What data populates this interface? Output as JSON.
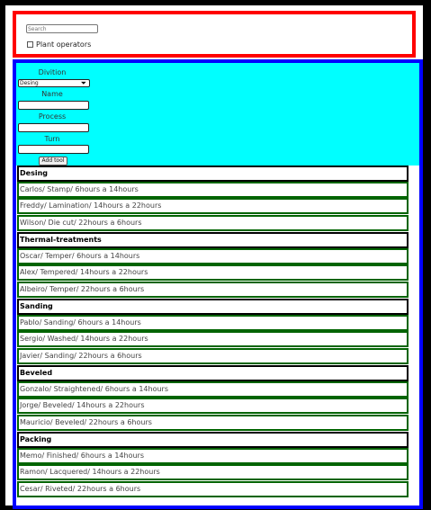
{
  "filter": {
    "search_placeholder": "Search",
    "checkbox_label": "Plant operators",
    "checkbox_checked": false
  },
  "form": {
    "division_label": "Divition",
    "division_selected": "Desing",
    "name_label": "Name",
    "process_label": "Process",
    "turn_label": "Turn",
    "add_button_label": "Add tool"
  },
  "groups": [
    {
      "title": "Desing",
      "items": [
        "Carlos/ Stamp/ 6hours a 14hours",
        "Freddy/ Lamination/ 14hours a 22hours",
        "Wilson/ Die cut/ 22hours a 6hours"
      ]
    },
    {
      "title": "Thermal-treatments",
      "items": [
        "Oscar/ Temper/ 6hours a 14hours",
        "Alex/ Tempered/ 14hours a 22hours",
        "Albeiro/ Temper/ 22hours a 6hours"
      ]
    },
    {
      "title": "Sanding",
      "items": [
        "Pablo/ Sanding/ 6hours a 14hours",
        "Sergio/ Washed/ 14hours a 22hours",
        "Javier/ Sanding/ 22hours a 6hours"
      ]
    },
    {
      "title": "Beveled",
      "items": [
        "Gonzalo/ Straightened/ 6hours a 14hours",
        "Jorge/ Beveled/ 14hours a 22hours",
        "Mauricio/ Beveled/ 22hours a 6hours"
      ]
    },
    {
      "title": "Packing",
      "items": [
        "Memo/ Finished/ 6hours a 14hours",
        "Ramon/ Lacquered/ 14hours a 22hours",
        "Cesar/ Riveted/ 22hours a 6hours"
      ]
    }
  ],
  "colors": {
    "filter_border": "#ff0000",
    "main_border": "#0000ff",
    "form_background": "#00ffff",
    "header_border": "#000000",
    "item_border": "#006400"
  }
}
